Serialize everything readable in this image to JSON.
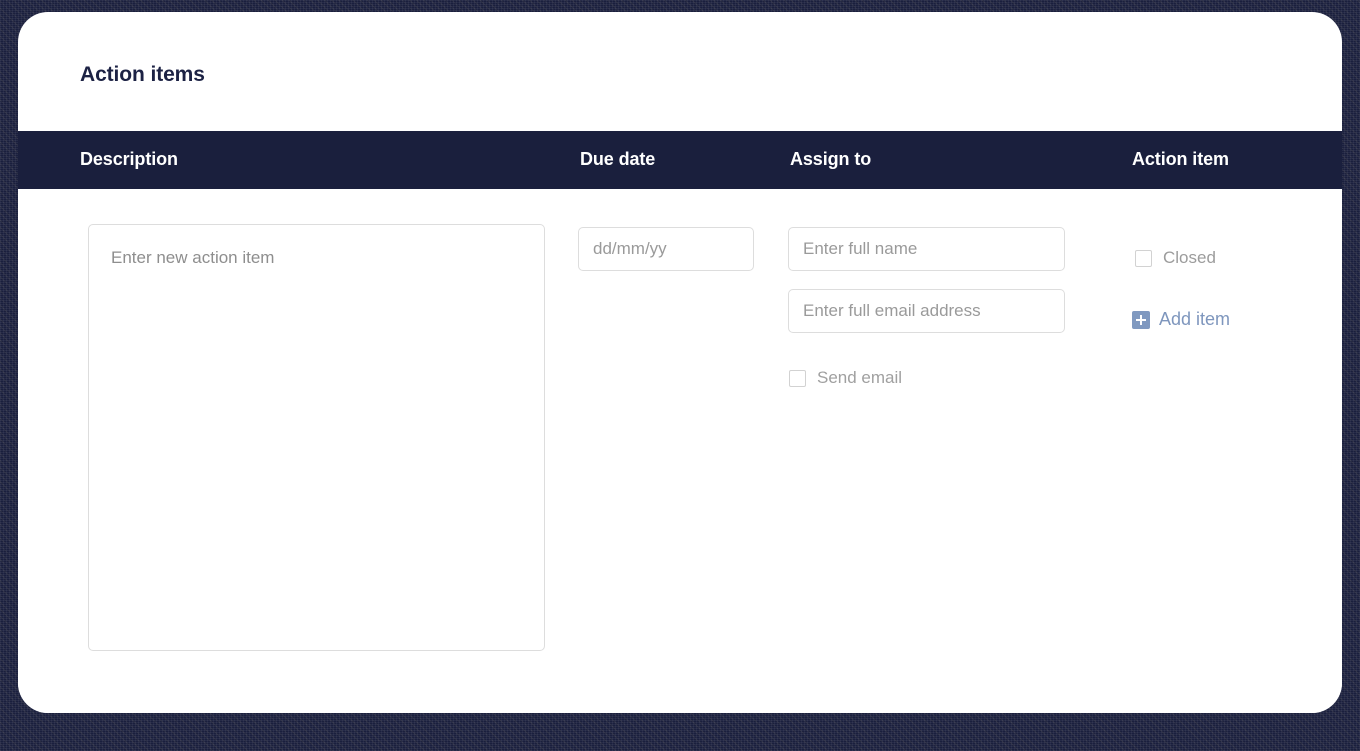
{
  "background": {
    "color": "#1a1f3d"
  },
  "card": {
    "background": "#ffffff",
    "title": "Action items"
  },
  "table": {
    "header": {
      "background": "#1a1f3d",
      "text_color": "#ffffff",
      "columns": [
        {
          "key": "description",
          "label": "Description"
        },
        {
          "key": "due_date",
          "label": "Due date"
        },
        {
          "key": "assign_to",
          "label": "Assign to"
        },
        {
          "key": "action_item",
          "label": "Action item"
        }
      ]
    },
    "row": {
      "description": {
        "textarea": {
          "placeholder": "Enter new action item",
          "value": ""
        }
      },
      "due_date": {
        "input": {
          "placeholder": "dd/mm/yy",
          "value": ""
        }
      },
      "assign_to": {
        "name_input": {
          "placeholder": "Enter full name",
          "value": ""
        },
        "email_input": {
          "placeholder": "Enter full email address",
          "value": ""
        },
        "send_email_checkbox": {
          "label": "Send email",
          "checked": false,
          "icon": "checkbox-unchecked-icon"
        }
      },
      "action_item": {
        "closed_checkbox": {
          "label": "Closed",
          "checked": false,
          "icon": "checkbox-unchecked-icon"
        },
        "add_item_button": {
          "label": "Add item",
          "icon": "plus-square-icon",
          "color": "#7e96bd"
        }
      }
    }
  }
}
